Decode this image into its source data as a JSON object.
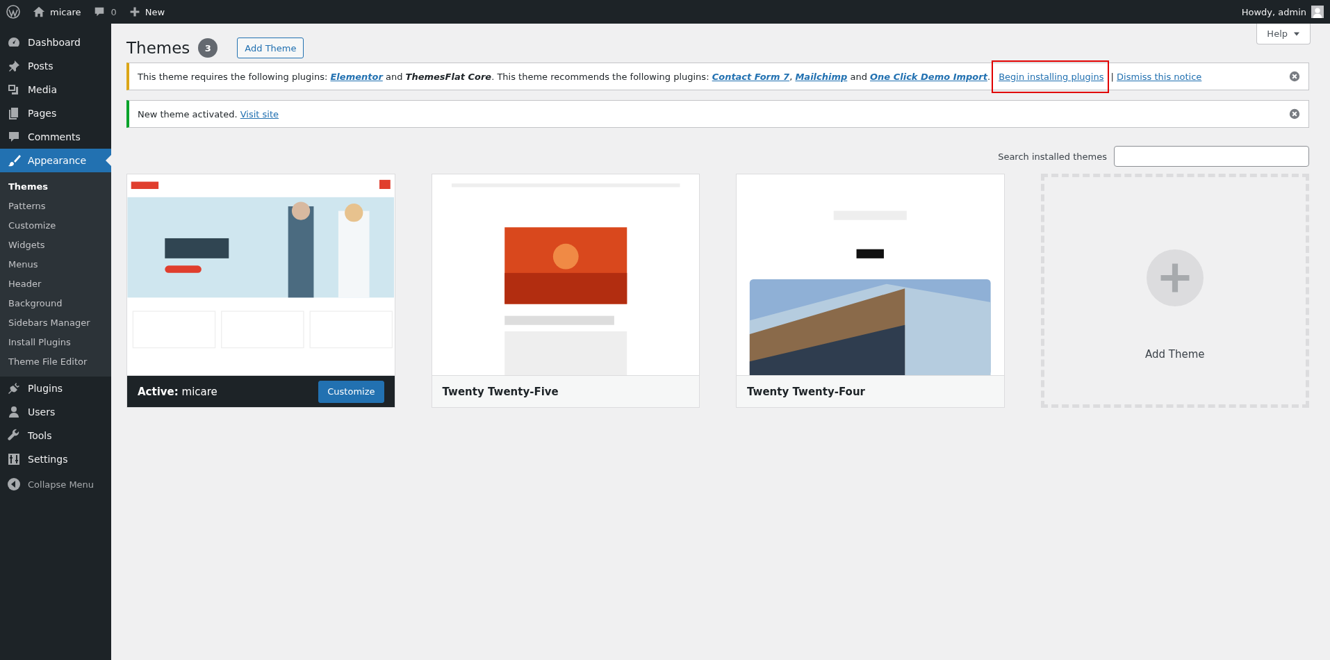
{
  "admin_bar": {
    "site_name": "micare",
    "comments_count": "0",
    "new_label": "New",
    "greeting": "Howdy, admin"
  },
  "sidebar": {
    "items": [
      {
        "label": "Dashboard",
        "selected": false
      },
      {
        "label": "Posts",
        "selected": false
      },
      {
        "label": "Media",
        "selected": false
      },
      {
        "label": "Pages",
        "selected": false
      },
      {
        "label": "Comments",
        "selected": false
      },
      {
        "label": "Appearance",
        "selected": true,
        "children": [
          {
            "label": "Themes",
            "selected": true
          },
          {
            "label": "Patterns",
            "selected": false
          },
          {
            "label": "Customize",
            "selected": false
          },
          {
            "label": "Widgets",
            "selected": false
          },
          {
            "label": "Menus",
            "selected": false
          },
          {
            "label": "Header",
            "selected": false
          },
          {
            "label": "Background",
            "selected": false
          },
          {
            "label": "Sidebars Manager",
            "selected": false
          },
          {
            "label": "Install Plugins",
            "selected": false
          },
          {
            "label": "Theme File Editor",
            "selected": false
          }
        ]
      },
      {
        "label": "Plugins",
        "selected": false
      },
      {
        "label": "Users",
        "selected": false
      },
      {
        "label": "Tools",
        "selected": false
      },
      {
        "label": "Settings",
        "selected": false
      }
    ],
    "collapse_label": "Collapse Menu"
  },
  "header": {
    "title": "Themes",
    "count": "3",
    "add_button": "Add Theme",
    "help_button": "Help"
  },
  "notices": [
    {
      "kind": "warning",
      "segments": [
        {
          "kind": "text",
          "text": "This theme requires the following plugins: "
        },
        {
          "kind": "plugin-link",
          "text": "Elementor"
        },
        {
          "kind": "text",
          "text": " and "
        },
        {
          "kind": "plugin",
          "text": "ThemesFlat Core"
        },
        {
          "kind": "text",
          "text": ". This theme recommends the following plugins: "
        },
        {
          "kind": "plugin-link",
          "text": "Contact Form 7"
        },
        {
          "kind": "text",
          "text": ", "
        },
        {
          "kind": "plugin-link",
          "text": "Mailchimp"
        },
        {
          "kind": "text",
          "text": " and "
        },
        {
          "kind": "plugin-link",
          "text": "One Click Demo Import"
        },
        {
          "kind": "text",
          "text": ". "
        },
        {
          "kind": "link",
          "text": "Begin installing plugins",
          "highlighted": true
        },
        {
          "kind": "text",
          "text": " | "
        },
        {
          "kind": "link",
          "text": "Dismiss this notice",
          "highlighted": false
        }
      ]
    },
    {
      "kind": "success",
      "segments": [
        {
          "kind": "text",
          "text": "New theme activated. "
        },
        {
          "kind": "link",
          "text": "Visit site",
          "highlighted": false
        }
      ]
    }
  ],
  "search": {
    "label": "Search installed themes"
  },
  "themes": [
    {
      "name": "micare",
      "active": true,
      "active_label": "Active:",
      "action": "Customize"
    },
    {
      "name": "Twenty Twenty-Five",
      "active": false
    },
    {
      "name": "Twenty Twenty-Four",
      "active": false
    }
  ],
  "add_card": {
    "label": "Add Theme"
  }
}
